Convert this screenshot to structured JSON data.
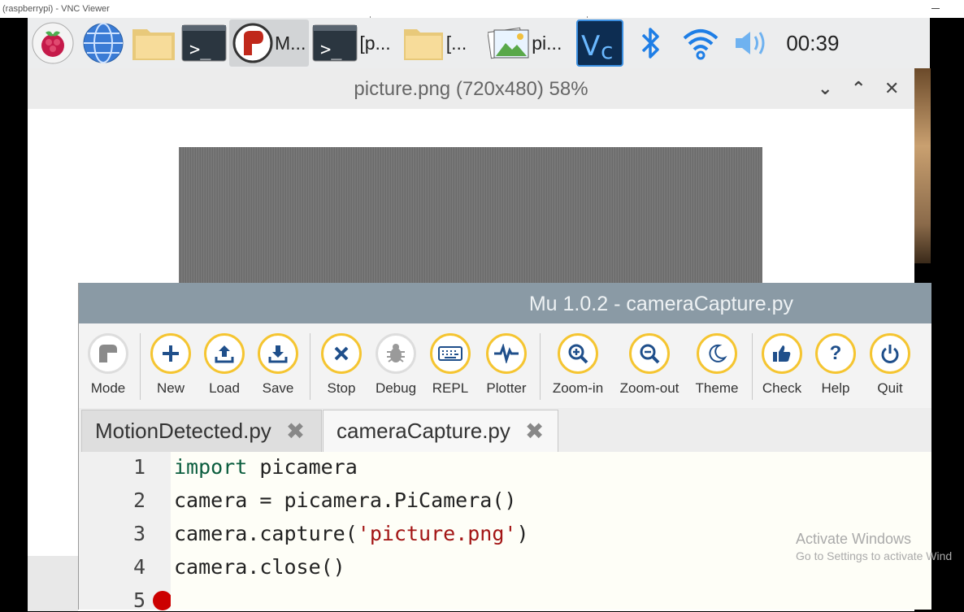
{
  "vnc": {
    "title": "(raspberrypi) - VNC Viewer"
  },
  "taskbar": {
    "apps": [
      {
        "icon": "mu-icon",
        "label": "M..."
      },
      {
        "icon": "terminal-icon",
        "label": "[p..."
      },
      {
        "icon": "folder-icon",
        "label": "[..."
      },
      {
        "icon": "image-viewer-icon",
        "label": "pi..."
      }
    ],
    "clock": "00:39"
  },
  "image_viewer": {
    "title": "picture.png (720x480) 58%"
  },
  "mu": {
    "title": "Mu 1.0.2 - cameraCapture.py",
    "toolbar": [
      {
        "label": "Mode",
        "icon": "mode-icon"
      },
      {
        "label": "New",
        "icon": "plus-icon"
      },
      {
        "label": "Load",
        "icon": "upload-icon"
      },
      {
        "label": "Save",
        "icon": "download-icon"
      },
      {
        "label": "Stop",
        "icon": "stop-x-icon"
      },
      {
        "label": "Debug",
        "icon": "bug-icon"
      },
      {
        "label": "REPL",
        "icon": "keyboard-icon"
      },
      {
        "label": "Plotter",
        "icon": "pulse-icon"
      },
      {
        "label": "Zoom-in",
        "icon": "zoom-in-icon"
      },
      {
        "label": "Zoom-out",
        "icon": "zoom-out-icon"
      },
      {
        "label": "Theme",
        "icon": "moon-icon"
      },
      {
        "label": "Check",
        "icon": "thumbs-up-icon"
      },
      {
        "label": "Help",
        "icon": "question-icon"
      },
      {
        "label": "Quit",
        "icon": "power-icon"
      }
    ],
    "tabs": [
      {
        "label": "MotionDetected.py"
      },
      {
        "label": "cameraCapture.py"
      }
    ],
    "code": {
      "lines": [
        {
          "n": "1",
          "kw": "import",
          "rest": " picamera"
        },
        {
          "n": "2",
          "text": "camera = picamera.PiCamera()"
        },
        {
          "n": "3",
          "pre": "camera.capture(",
          "str": "'picture.png'",
          "post": ")"
        },
        {
          "n": "4",
          "text": "camera.close()"
        },
        {
          "n": "5"
        }
      ]
    }
  },
  "watermark": {
    "line1": "Activate Windows",
    "line2": "Go to Settings to activate Wind"
  },
  "colors": {
    "toolbar_accent": "#f5c531",
    "mu_titlebar": "#8a9aa5",
    "keyword": "#0b5d3e",
    "string": "#a31515",
    "breakpoint": "#cc0000"
  }
}
